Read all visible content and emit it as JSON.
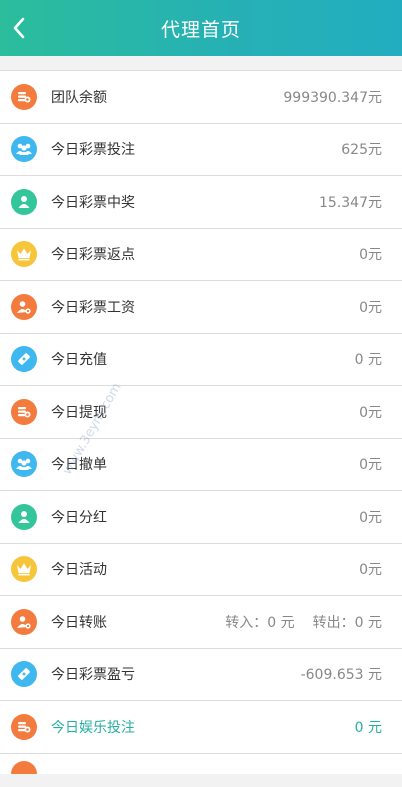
{
  "header": {
    "title": "代理首页",
    "back_icon": "chevron-left-icon"
  },
  "colors": {
    "orange": "#f47b3e",
    "blue": "#3fb7ef",
    "green": "#33c69a",
    "yellow": "#f6c53a",
    "teal": "#27b0a2"
  },
  "rows": [
    {
      "label": "团队余额",
      "value": "999390.347元",
      "icon": "coins-icon"
    },
    {
      "label": "今日彩票投注",
      "value": "625元",
      "icon": "team-icon"
    },
    {
      "label": "今日彩票中奖",
      "value": "15.347元",
      "icon": "user-icon"
    },
    {
      "label": "今日彩票返点",
      "value": "0元",
      "icon": "crown-icon"
    },
    {
      "label": "今日彩票工资",
      "value": "0元",
      "icon": "user-coin-icon"
    },
    {
      "label": "今日充值",
      "value": "0 元",
      "icon": "ticket-icon"
    },
    {
      "label": "今日提现",
      "value": "0元",
      "icon": "coins-icon"
    },
    {
      "label": "今日撤单",
      "value": "0元",
      "icon": "team-icon"
    },
    {
      "label": "今日分红",
      "value": "0元",
      "icon": "user-icon"
    },
    {
      "label": "今日活动",
      "value": "0元",
      "icon": "crown-icon"
    },
    {
      "label": "今日转账",
      "value": "转入：0 元",
      "value2": "转出：0 元",
      "icon": "user-coin-icon"
    },
    {
      "label": "今日彩票盈亏",
      "value": "-609.653 元",
      "icon": "ticket-icon"
    },
    {
      "label": "今日娱乐投注",
      "value": "0 元",
      "icon": "coins-icon"
    }
  ],
  "watermark": "www.3eym.com"
}
